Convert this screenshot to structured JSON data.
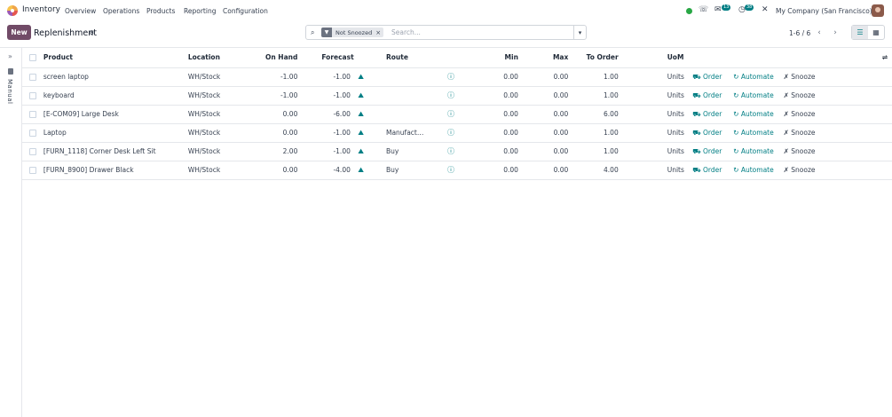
{
  "nav": {
    "app": "Inventory",
    "menu": [
      "Overview",
      "Operations",
      "Products",
      "Reporting",
      "Configuration"
    ],
    "messages_count": "13",
    "activities_count": "38",
    "company": "My Company (San Francisco)"
  },
  "control": {
    "new_label": "New",
    "breadcrumb": "Replenishment",
    "facet": "Not Snoozed",
    "search_placeholder": "Search...",
    "pager": "1-6 / 6"
  },
  "side": {
    "label": "Manual"
  },
  "columns": [
    "Product",
    "Location",
    "On Hand",
    "Forecast",
    "Route",
    "Min",
    "Max",
    "To Order",
    "UoM"
  ],
  "rows": [
    {
      "product": "screen laptop",
      "location": "WH/Stock",
      "on_hand": "-1.00",
      "forecast": "-1.00",
      "route": "",
      "min": "0.00",
      "max": "0.00",
      "to_order": "1.00",
      "uom": "Units"
    },
    {
      "product": "keyboard",
      "location": "WH/Stock",
      "on_hand": "-1.00",
      "forecast": "-1.00",
      "route": "",
      "min": "0.00",
      "max": "0.00",
      "to_order": "1.00",
      "uom": "Units"
    },
    {
      "product": "[E-COM09] Large Desk",
      "location": "WH/Stock",
      "on_hand": "0.00",
      "forecast": "-6.00",
      "route": "",
      "min": "0.00",
      "max": "0.00",
      "to_order": "6.00",
      "uom": "Units"
    },
    {
      "product": "Laptop",
      "location": "WH/Stock",
      "on_hand": "0.00",
      "forecast": "-1.00",
      "route": "Manufact…",
      "min": "0.00",
      "max": "0.00",
      "to_order": "1.00",
      "uom": "Units"
    },
    {
      "product": "[FURN_1118] Corner Desk Left Sit",
      "location": "WH/Stock",
      "on_hand": "2.00",
      "forecast": "-1.00",
      "route": "Buy",
      "min": "0.00",
      "max": "0.00",
      "to_order": "1.00",
      "uom": "Units"
    },
    {
      "product": "[FURN_8900] Drawer Black",
      "location": "WH/Stock",
      "on_hand": "0.00",
      "forecast": "-4.00",
      "route": "Buy",
      "min": "0.00",
      "max": "0.00",
      "to_order": "4.00",
      "uom": "Units"
    }
  ],
  "actions": {
    "order": "Order",
    "automate": "Automate",
    "snooze": "Snooze"
  }
}
